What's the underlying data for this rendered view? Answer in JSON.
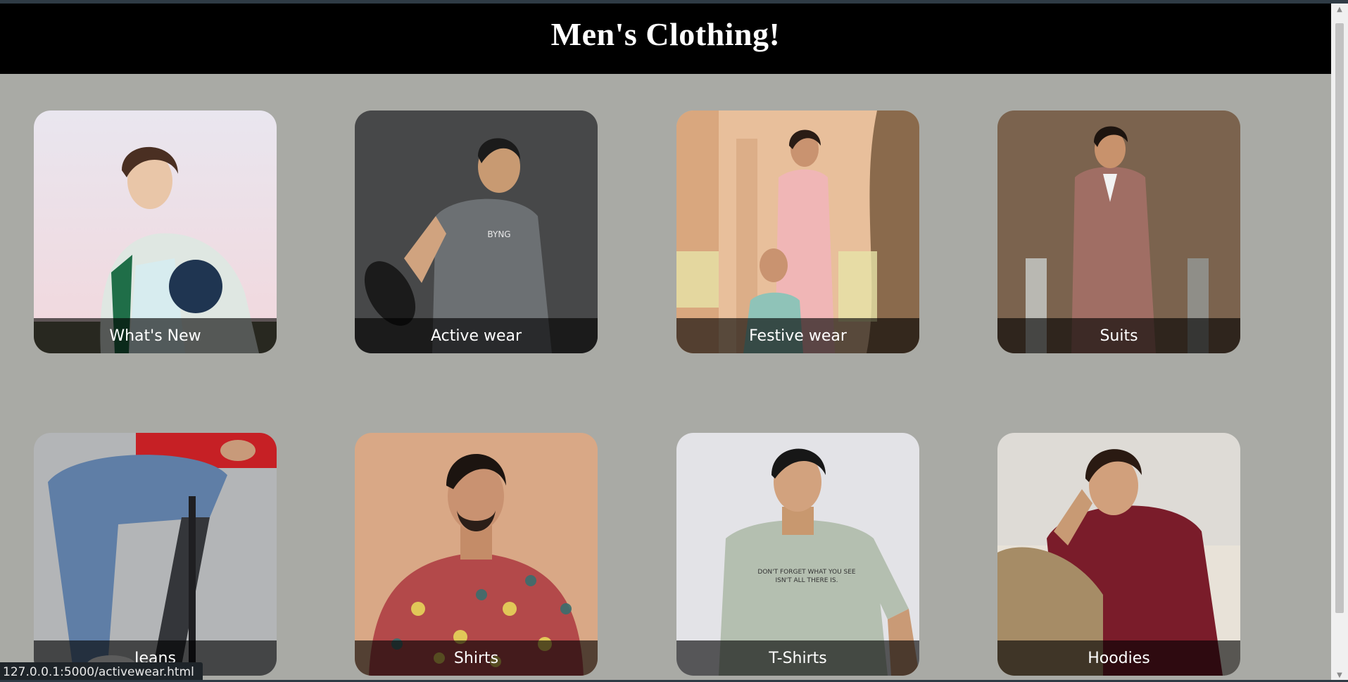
{
  "header": {
    "title": "Men's Clothing!"
  },
  "cards": [
    {
      "label": "What's New",
      "icon": "whats-new-photo"
    },
    {
      "label": "Active wear",
      "icon": "active-wear-photo"
    },
    {
      "label": "Festive wear",
      "icon": "festive-wear-photo"
    },
    {
      "label": "Suits",
      "icon": "suits-photo"
    },
    {
      "label": "Jeans",
      "icon": "jeans-photo"
    },
    {
      "label": "Shirts",
      "icon": "shirts-photo"
    },
    {
      "label": "T-Shirts",
      "icon": "t-shirts-photo"
    },
    {
      "label": "Hoodies",
      "icon": "hoodies-photo"
    }
  ],
  "status": {
    "url": "127.0.0.1:5000/activewear.html"
  },
  "colors": {
    "background": "#a9aaa5",
    "header": "#000000",
    "caption_overlay": "rgba(0,0,0,0.62)"
  }
}
